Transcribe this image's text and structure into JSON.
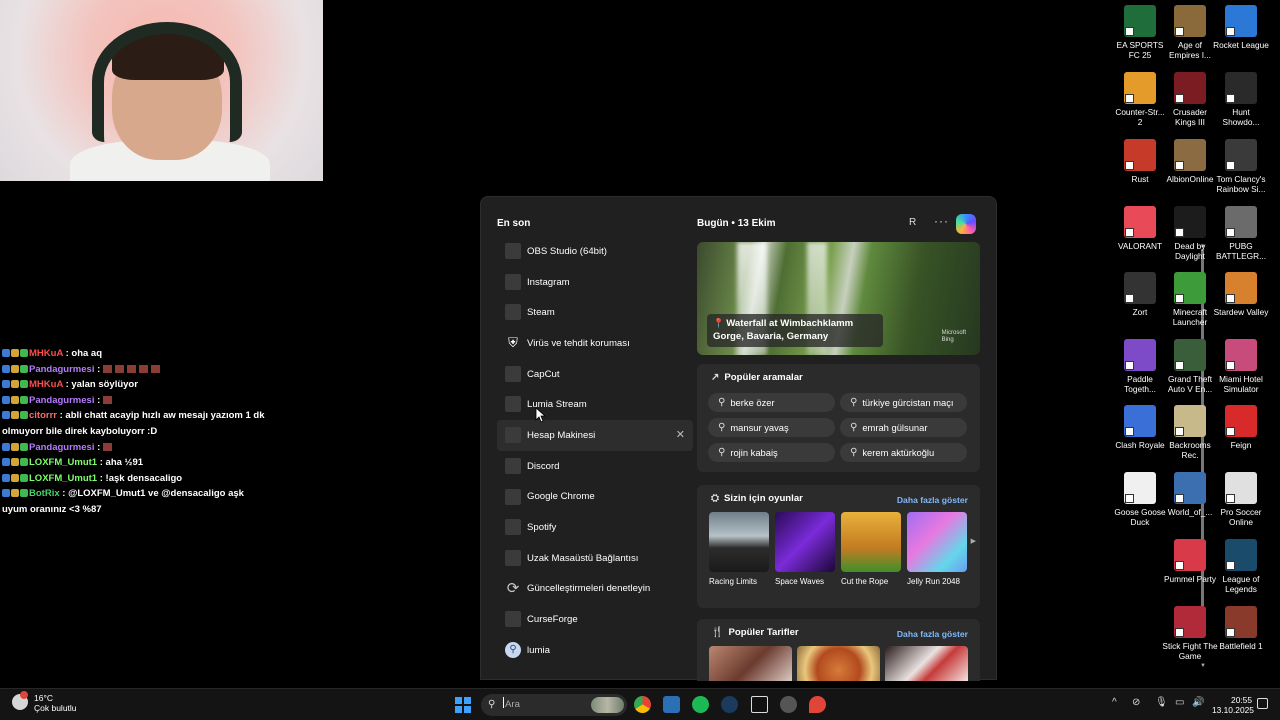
{
  "chat": [
    {
      "user": "MHKuA",
      "user_color": "#ff4d4d",
      "text": " : oha aq"
    },
    {
      "user": "Pandagurmesi",
      "user_color": "#b57bff",
      "text": " : "
    },
    {
      "user": "MHKuA",
      "user_color": "#ff4d4d",
      "text": " : yalan söylüyor"
    },
    {
      "user": "Pandagurmesi",
      "user_color": "#b57bff",
      "text": " : "
    },
    {
      "user": "citorrr",
      "user_color": "#ff6b6b",
      "text": " : abli chatt acayip hızlı aw mesajı yazıom 1 dk"
    },
    {
      "user": "",
      "user_color": "#ffffff",
      "text": "olmuyorr bile direk kayboluyorr :D"
    },
    {
      "user": "Pandagurmesi",
      "user_color": "#b57bff",
      "text": " : "
    },
    {
      "user": "LOXFM_Umut1",
      "user_color": "#7dff6b",
      "text": " : aha ½91"
    },
    {
      "user": "LOXFM_Umut1",
      "user_color": "#7dff6b",
      "text": " : !aşk densacaligo"
    },
    {
      "user": "BotRix",
      "user_color": "#46d36b",
      "text": " : @LOXFM_Umut1 ve @densacaligo aşk"
    },
    {
      "user": "",
      "user_color": "#ffffff",
      "text": "uyum oranınız <3 %87"
    }
  ],
  "start_menu": {
    "recent_title": "En son",
    "apps": [
      {
        "label": "OBS Studio (64bit)",
        "icon": "app-icon"
      },
      {
        "label": "Instagram",
        "icon": "app-icon"
      },
      {
        "label": "Steam",
        "icon": "app-icon"
      },
      {
        "label": "Virüs ve tehdit koruması",
        "icon": "shield-icon"
      },
      {
        "label": "CapCut",
        "icon": "app-icon"
      },
      {
        "label": "Lumia Stream",
        "icon": "app-icon"
      },
      {
        "label": "Hesap Makinesi",
        "icon": "app-icon"
      },
      {
        "label": "Discord",
        "icon": "app-icon"
      },
      {
        "label": "Google Chrome",
        "icon": "app-icon"
      },
      {
        "label": "Spotify",
        "icon": "app-icon"
      },
      {
        "label": "Uzak Masaüstü Bağlantısı",
        "icon": "app-icon"
      },
      {
        "label": "Güncelleştirmeleri denetleyin",
        "icon": "refresh-icon"
      },
      {
        "label": "CurseForge",
        "icon": "app-icon"
      },
      {
        "label": "lumia",
        "icon": "search-icon"
      }
    ],
    "close_glyph": "✕",
    "today": "Bugün • 13 Ekim",
    "avatar_letter": "R",
    "more": "···",
    "hero": {
      "pin": "⬤",
      "caption_line1": "Waterfall at Wimbachklamm",
      "caption_line2": "Gorge, Bavaria, Germany",
      "credit_line1": "Microsoft",
      "credit_line2": "Bing"
    },
    "popular_searches": {
      "title": "Popüler aramalar",
      "items": [
        "berke özer",
        "türkiye gürcistan maçı",
        "mansur yavaş",
        "emrah gülsunar",
        "rojin kabaiş",
        "kerem aktürkoğlu"
      ]
    },
    "games": {
      "title": "Sizin için oyunlar",
      "link": "Daha fazla göster",
      "items": [
        "Racing Limits",
        "Space Waves",
        "Cut the Rope",
        "Jelly Run 2048"
      ]
    },
    "recipes": {
      "title": "Popüler Tarifler",
      "link": "Daha fazla göster"
    }
  },
  "desktop_icons": [
    {
      "label": "EA SPORTS FC 25",
      "color": "#1f6d3a"
    },
    {
      "label": "Age of Empires I...",
      "color": "#8a6a3a"
    },
    {
      "label": "Rocket League",
      "color": "#2b78d6"
    },
    {
      "label": "Counter-Str... 2",
      "color": "#e49b2a"
    },
    {
      "label": "Crusader Kings III",
      "color": "#7b1c22"
    },
    {
      "label": "Hunt Showdo...",
      "color": "#2a2a2a"
    },
    {
      "label": "Rust",
      "color": "#c63a2a"
    },
    {
      "label": "AlbionOnline",
      "color": "#8b6b42"
    },
    {
      "label": "Tom Clancy's Rainbow Si...",
      "color": "#3a3a3a"
    },
    {
      "label": "VALORANT",
      "color": "#e84a57"
    },
    {
      "label": "Dead by Daylight",
      "color": "#1c1c1c"
    },
    {
      "label": "PUBG BATTLEGR...",
      "color": "#6b6b6b"
    },
    {
      "label": "Zort",
      "color": "#333"
    },
    {
      "label": "Minecraft Launcher",
      "color": "#3d9b3a"
    },
    {
      "label": "Stardew Valley",
      "color": "#d7812f"
    },
    {
      "label": "Paddle Togeth...",
      "color": "#7e4bc8"
    },
    {
      "label": "Grand Theft Auto V En...",
      "color": "#3b5e3a"
    },
    {
      "label": "Miami Hotel Simulator",
      "color": "#c84c7b"
    },
    {
      "label": "Clash Royale",
      "color": "#3a6fd8"
    },
    {
      "label": "Backrooms Rec.",
      "color": "#c8b98a"
    },
    {
      "label": "Feign",
      "color": "#d82a2a"
    },
    {
      "label": "Goose Goose Duck",
      "color": "#f0f0f0"
    },
    {
      "label": "World_of_...",
      "color": "#3b6fb0"
    },
    {
      "label": "Pro Soccer Online",
      "color": "#e0e0e0"
    },
    {
      "label": "Pummel Party",
      "color": "#d83a4a"
    },
    {
      "label": "League of Legends",
      "color": "#1b4b6b"
    },
    {
      "label": "Stick Fight The Game",
      "color": "#b02a3a"
    },
    {
      "label": "Battlefield 1",
      "color": "#8a3a2a"
    }
  ],
  "taskbar": {
    "temperature": "16°C",
    "weather": "Çok bulutlu",
    "search_placeholder": "Ara",
    "time": "20:55",
    "date": "13.10.2025",
    "tray_chevron": "^"
  }
}
